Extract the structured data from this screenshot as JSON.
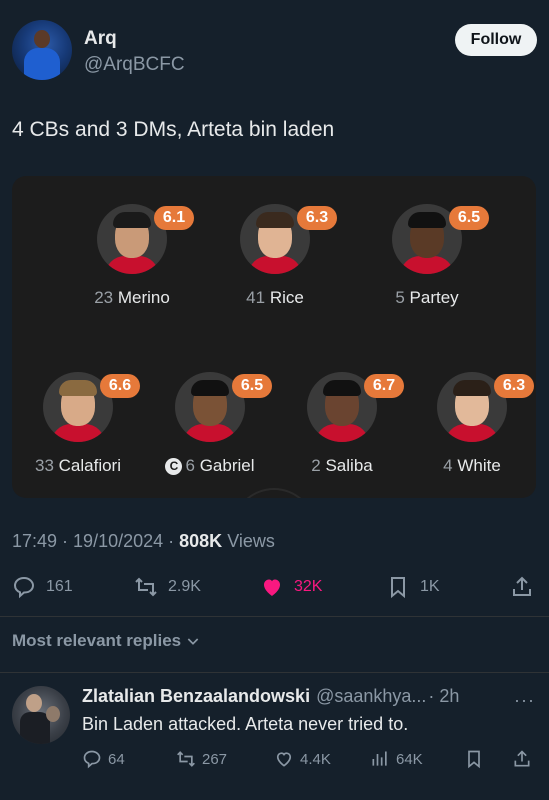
{
  "tweet": {
    "author_name": "Arq",
    "author_handle": "@ArqBCFC",
    "follow_label": "Follow",
    "text": "4 CBs and 3 DMs, Arteta bin laden",
    "time": "17:49",
    "date": "19/10/2024",
    "views_count": "808K",
    "views_label": "Views",
    "replies": "161",
    "reposts": "2.9K",
    "likes": "32K",
    "bookmarks": "1K"
  },
  "lineup": {
    "rating_color": "#e6793a",
    "players": [
      {
        "number": "23",
        "name": "Merino",
        "rating": "6.1",
        "captain": false
      },
      {
        "number": "41",
        "name": "Rice",
        "rating": "6.3",
        "captain": false
      },
      {
        "number": "5",
        "name": "Partey",
        "rating": "6.5",
        "captain": false
      },
      {
        "number": "33",
        "name": "Calafiori",
        "rating": "6.6",
        "captain": false
      },
      {
        "number": "6",
        "name": "Gabriel",
        "rating": "6.5",
        "captain": true,
        "captain_mark": "C"
      },
      {
        "number": "2",
        "name": "Saliba",
        "rating": "6.7",
        "captain": false
      },
      {
        "number": "4",
        "name": "White",
        "rating": "6.3",
        "captain": false
      }
    ]
  },
  "replies_section": {
    "label": "Most relevant replies"
  },
  "reply": {
    "name": "Zlatalian Benzaalandowski",
    "handle": "@saankhya...",
    "time": "· 2h",
    "more": "···",
    "text": "Bin Laden attacked. Arteta never tried to.",
    "replies": "64",
    "reposts": "267",
    "likes": "4.4K",
    "views": "64K"
  },
  "colors": {
    "background": "#15202b",
    "like_pink": "#f91880",
    "muted": "#8b98a5"
  }
}
